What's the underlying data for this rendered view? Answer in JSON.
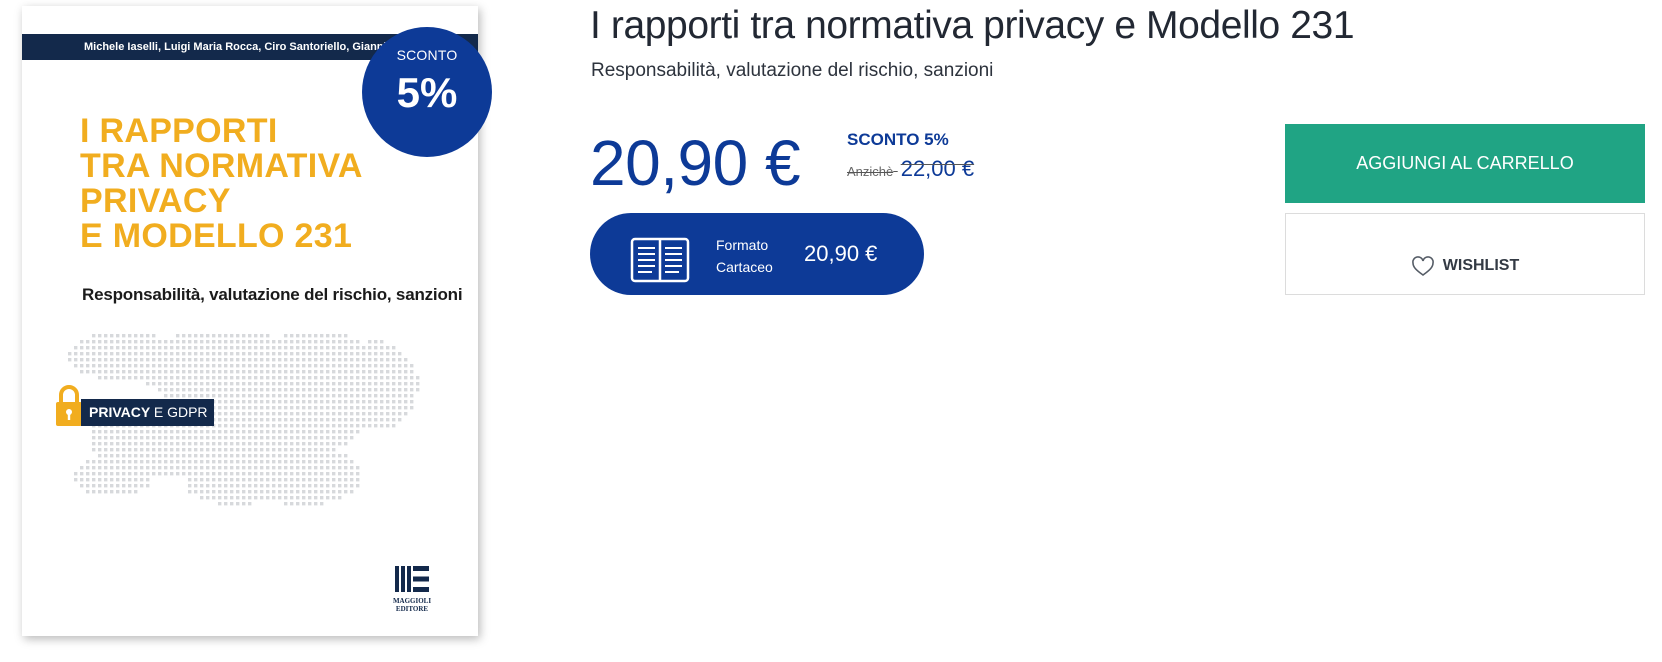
{
  "product": {
    "title": "I rapporti tra normativa privacy e Modello 231",
    "subtitle": "Responsabilità, valutazione del rischio, sanzioni",
    "price": "20,90 €",
    "discount_label": "SCONTO 5%",
    "old_price_prefix": "Anzichè",
    "old_price": "22,00 €"
  },
  "format": {
    "label_line1": "Formato",
    "label_line2": "Cartaceo",
    "price": "20,90 €",
    "icon": "book-icon"
  },
  "actions": {
    "add_to_cart": "AGGIUNGI AL CARRELLO",
    "wishlist": "WISHLIST",
    "wishlist_icon": "heart-icon"
  },
  "badge": {
    "label": "SCONTO",
    "value": "5%"
  },
  "cover": {
    "authors": "Michele Iaselli, Luigi Maria Rocca, Ciro Santoriello, Gianpiero U",
    "title_lines": [
      "I RAPPORTI",
      "TRA NORMATIVA",
      "PRIVACY",
      "E MODELLO 231"
    ],
    "subtitle": "Responsabilità, valutazione del rischio, sanzioni",
    "tag_bold": "PRIVACY",
    "tag_rest": "E GDPR",
    "publisher_line1": "MAGGIOLI",
    "publisher_line2": "EDITORE"
  },
  "colors": {
    "brand_blue": "#0d3a97",
    "navy": "#13294b",
    "cart_green": "#20a484",
    "cover_yellow": "#f1ad1f"
  }
}
